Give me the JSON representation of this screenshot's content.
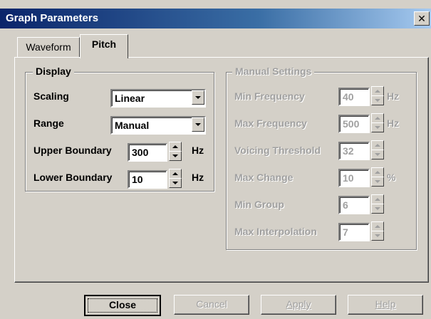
{
  "window": {
    "title": "Graph Parameters",
    "close_glyph": "✕"
  },
  "tabs": [
    {
      "label": "Waveform",
      "active": false
    },
    {
      "label": "Pitch",
      "active": true
    }
  ],
  "display": {
    "group_title": "Display",
    "scaling": {
      "label": "Scaling",
      "value": "Linear"
    },
    "range": {
      "label": "Range",
      "value": "Manual"
    },
    "upper": {
      "label": "Upper Boundary",
      "value": "300",
      "unit": "Hz"
    },
    "lower": {
      "label": "Lower Boundary",
      "value": "10",
      "unit": "Hz"
    }
  },
  "manual": {
    "group_title": "Manual Settings",
    "enabled": false,
    "min_freq": {
      "label": "Min Frequency",
      "value": "40",
      "unit": "Hz"
    },
    "max_freq": {
      "label": "Max Frequency",
      "value": "500",
      "unit": "Hz"
    },
    "voicing": {
      "label": "Voicing Threshold",
      "value": "32",
      "unit": ""
    },
    "max_change": {
      "label": "Max Change",
      "value": "10",
      "unit": "%"
    },
    "min_group": {
      "label": "Min Group",
      "value": "6",
      "unit": ""
    },
    "max_interp": {
      "label": "Max Interpolation",
      "value": "7",
      "unit": ""
    }
  },
  "buttons": {
    "close": "Close",
    "cancel": "Cancel",
    "apply": "Apply",
    "help": "Help"
  },
  "colors": {
    "face": "#d4d0c8",
    "title_start": "#0a246a",
    "title_end": "#a6caf0",
    "disabled_text": "#a0a0a0"
  }
}
